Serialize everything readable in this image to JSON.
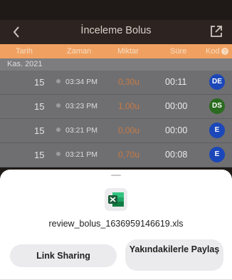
{
  "nav": {
    "title": "İnceleme Bolus"
  },
  "table": {
    "headers": {
      "date": "Tarih",
      "time": "Zaman",
      "amount": "Miktar",
      "duration": "Süre",
      "code": "Kod"
    },
    "month": "Kas. 2021",
    "rows": [
      {
        "day": "15",
        "time": "03:34 PM",
        "amount": "0,30u",
        "duration": "00:11",
        "code": "DE",
        "color": "#1b47b8"
      },
      {
        "day": "15",
        "time": "03:23 PM",
        "amount": "1,00u",
        "duration": "00:00",
        "code": "DS",
        "color": "#2a6b1f"
      },
      {
        "day": "15",
        "time": "03:21 PM",
        "amount": "0,00u",
        "duration": "00:00",
        "code": "E",
        "color": "#1b47b8"
      },
      {
        "day": "15",
        "time": "03:21 PM",
        "amount": "0,70u",
        "duration": "00:08",
        "code": "E",
        "color": "#1b47b8"
      }
    ]
  },
  "sheet": {
    "file_icon": "excel-icon",
    "filename": "review_bolus_1636959146619.xls",
    "link_sharing": "Link Sharing",
    "nearby_share": "Yakındakilerle Paylaş"
  },
  "colors": {
    "accent": "#f0a161",
    "nav_bg": "#2d2320",
    "excel_green": "#1d7a43"
  }
}
